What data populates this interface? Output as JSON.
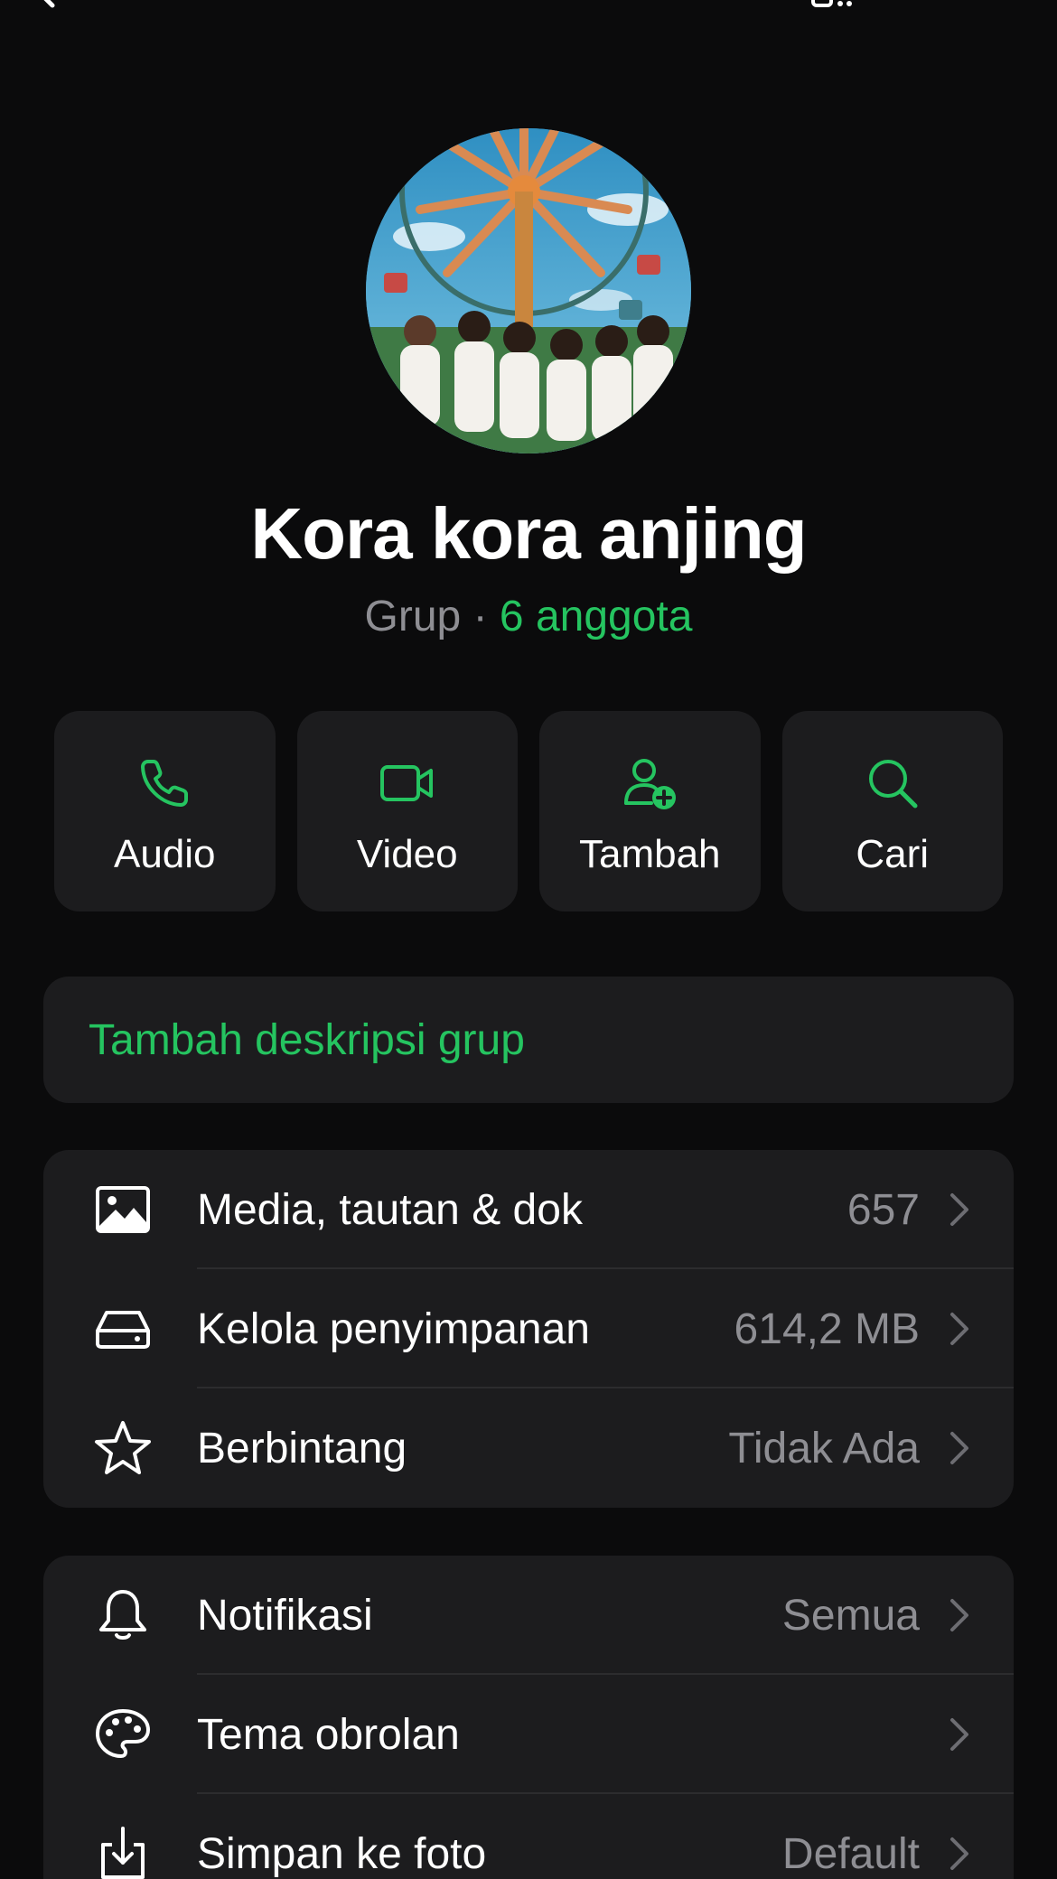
{
  "group": {
    "name": "Kora kora anjing",
    "type": "Grup",
    "separator": "·",
    "members": "6 anggota"
  },
  "actions": [
    {
      "label": "Audio",
      "icon": "phone-icon"
    },
    {
      "label": "Video",
      "icon": "video-camera-icon"
    },
    {
      "label": "Tambah",
      "icon": "add-person-icon"
    },
    {
      "label": "Cari",
      "icon": "search-icon"
    }
  ],
  "description": {
    "add_label": "Tambah deskripsi grup"
  },
  "section1": [
    {
      "label": "Media, tautan & dok",
      "value": "657",
      "icon": "image-icon"
    },
    {
      "label": "Kelola penyimpanan",
      "value": "614,2 MB",
      "icon": "storage-drive-icon"
    },
    {
      "label": "Berbintang",
      "value": "Tidak Ada",
      "icon": "star-icon"
    }
  ],
  "section2": [
    {
      "label": "Notifikasi",
      "value": "Semua",
      "icon": "bell-icon"
    },
    {
      "label": "Tema obrolan",
      "value": "",
      "icon": "palette-icon"
    },
    {
      "label": "Simpan ke foto",
      "value": "Default",
      "icon": "save-download-icon"
    }
  ],
  "colors": {
    "accent": "#25c460",
    "background": "#0b0b0c",
    "card": "#1c1c1e",
    "secondary_text": "#8e8e93"
  }
}
